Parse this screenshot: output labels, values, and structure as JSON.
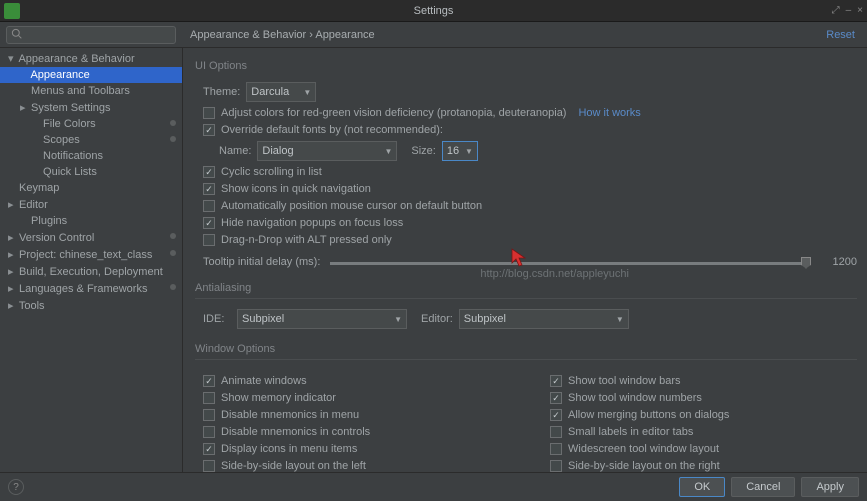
{
  "window": {
    "title": "Settings",
    "reset": "Reset"
  },
  "breadcrumb": "Appearance & Behavior › Appearance",
  "search": {
    "placeholder": ""
  },
  "sidebar": [
    {
      "label": "Appearance & Behavior",
      "lvl": 0,
      "exp": true
    },
    {
      "label": "Appearance",
      "lvl": 1,
      "sel": true
    },
    {
      "label": "Menus and Toolbars",
      "lvl": 1
    },
    {
      "label": "System Settings",
      "lvl": 1,
      "exp": false,
      "arrow": true
    },
    {
      "label": "File Colors",
      "lvl": 2,
      "dot": true
    },
    {
      "label": "Scopes",
      "lvl": 2,
      "dot": true
    },
    {
      "label": "Notifications",
      "lvl": 2
    },
    {
      "label": "Quick Lists",
      "lvl": 2
    },
    {
      "label": "Keymap",
      "lvl": 0
    },
    {
      "label": "Editor",
      "lvl": 0,
      "arrow": true
    },
    {
      "label": "Plugins",
      "lvl": 0,
      "indent": true
    },
    {
      "label": "Version Control",
      "lvl": 0,
      "arrow": true,
      "dot": true
    },
    {
      "label": "Project: chinese_text_class",
      "lvl": 0,
      "arrow": true,
      "dot": true
    },
    {
      "label": "Build, Execution, Deployment",
      "lvl": 0,
      "arrow": true
    },
    {
      "label": "Languages & Frameworks",
      "lvl": 0,
      "arrow": true,
      "dot": true
    },
    {
      "label": "Tools",
      "lvl": 0,
      "arrow": true
    }
  ],
  "ui": {
    "section": "UI Options",
    "theme_label": "Theme:",
    "theme": "Darcula",
    "adjust_colors": "Adjust colors for red-green vision deficiency (protanopia, deuteranopia)",
    "how": "How it works",
    "override": "Override default fonts by (not recommended):",
    "name_label": "Name:",
    "name_value": "Dialog",
    "size_label": "Size:",
    "size_value": "16",
    "cyclic": "Cyclic scrolling in list",
    "show_icons": "Show icons in quick navigation",
    "auto_pos": "Automatically position mouse cursor on default button",
    "hide_nav": "Hide navigation popups on focus loss",
    "dnd_alt": "Drag-n-Drop with ALT pressed only",
    "tooltip_label": "Tooltip initial delay (ms):",
    "tooltip_value": "1200",
    "watermark": "http://blog.csdn.net/appleyuchi"
  },
  "aa": {
    "section": "Antialiasing",
    "ide_label": "IDE:",
    "ide": "Subpixel",
    "editor_label": "Editor:",
    "editor": "Subpixel"
  },
  "wo": {
    "section": "Window Options",
    "left": [
      {
        "label": "Animate windows",
        "on": true
      },
      {
        "label": "Show memory indicator",
        "on": false
      },
      {
        "label": "Disable mnemonics in menu",
        "on": false
      },
      {
        "label": "Disable mnemonics in controls",
        "on": false
      },
      {
        "label": "Display icons in menu items",
        "on": true
      },
      {
        "label": "Side-by-side layout on the left",
        "on": false
      }
    ],
    "right": [
      {
        "label": "Show tool window bars",
        "on": true
      },
      {
        "label": "Show tool window numbers",
        "on": true
      },
      {
        "label": "Allow merging buttons on dialogs",
        "on": true
      },
      {
        "label": "Small labels in editor tabs",
        "on": false
      },
      {
        "label": "Widescreen tool window layout",
        "on": false
      },
      {
        "label": "Side-by-side layout on the right",
        "on": false
      }
    ]
  },
  "footer": {
    "ok": "OK",
    "cancel": "Cancel",
    "apply": "Apply"
  }
}
